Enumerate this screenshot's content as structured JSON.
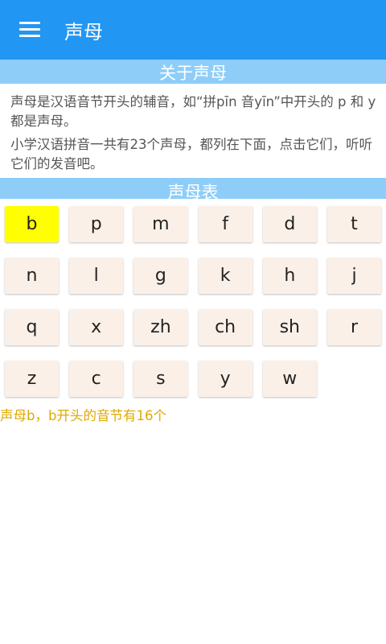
{
  "app": {
    "title": "声母",
    "menu_icon": "menu-icon"
  },
  "about": {
    "header": "关于声母",
    "paragraph1": "声母是汉语音节开头的辅音，如“拼pīn 音yīn”中开头的 p 和 y 都是声母。",
    "paragraph2": "小学汉语拼音一共有23个声母，都列在下面，点击它们，听听它们的发音吧。"
  },
  "table": {
    "header": "声母表",
    "selected": "b",
    "rows": [
      [
        "b",
        "p",
        "m",
        "f",
        "d",
        "t"
      ],
      [
        "n",
        "l",
        "g",
        "k",
        "h",
        "j"
      ],
      [
        "q",
        "x",
        "zh",
        "ch",
        "sh",
        "r"
      ],
      [
        "z",
        "c",
        "s",
        "y",
        "w"
      ]
    ]
  },
  "status": "声母b，b开头的音节有16个",
  "colors": {
    "appbar": "#2196f3",
    "section_header": "#8ecdf8",
    "selected_key": "#ffff00",
    "key": "#fbf0e8",
    "status_text": "#e0a800"
  }
}
